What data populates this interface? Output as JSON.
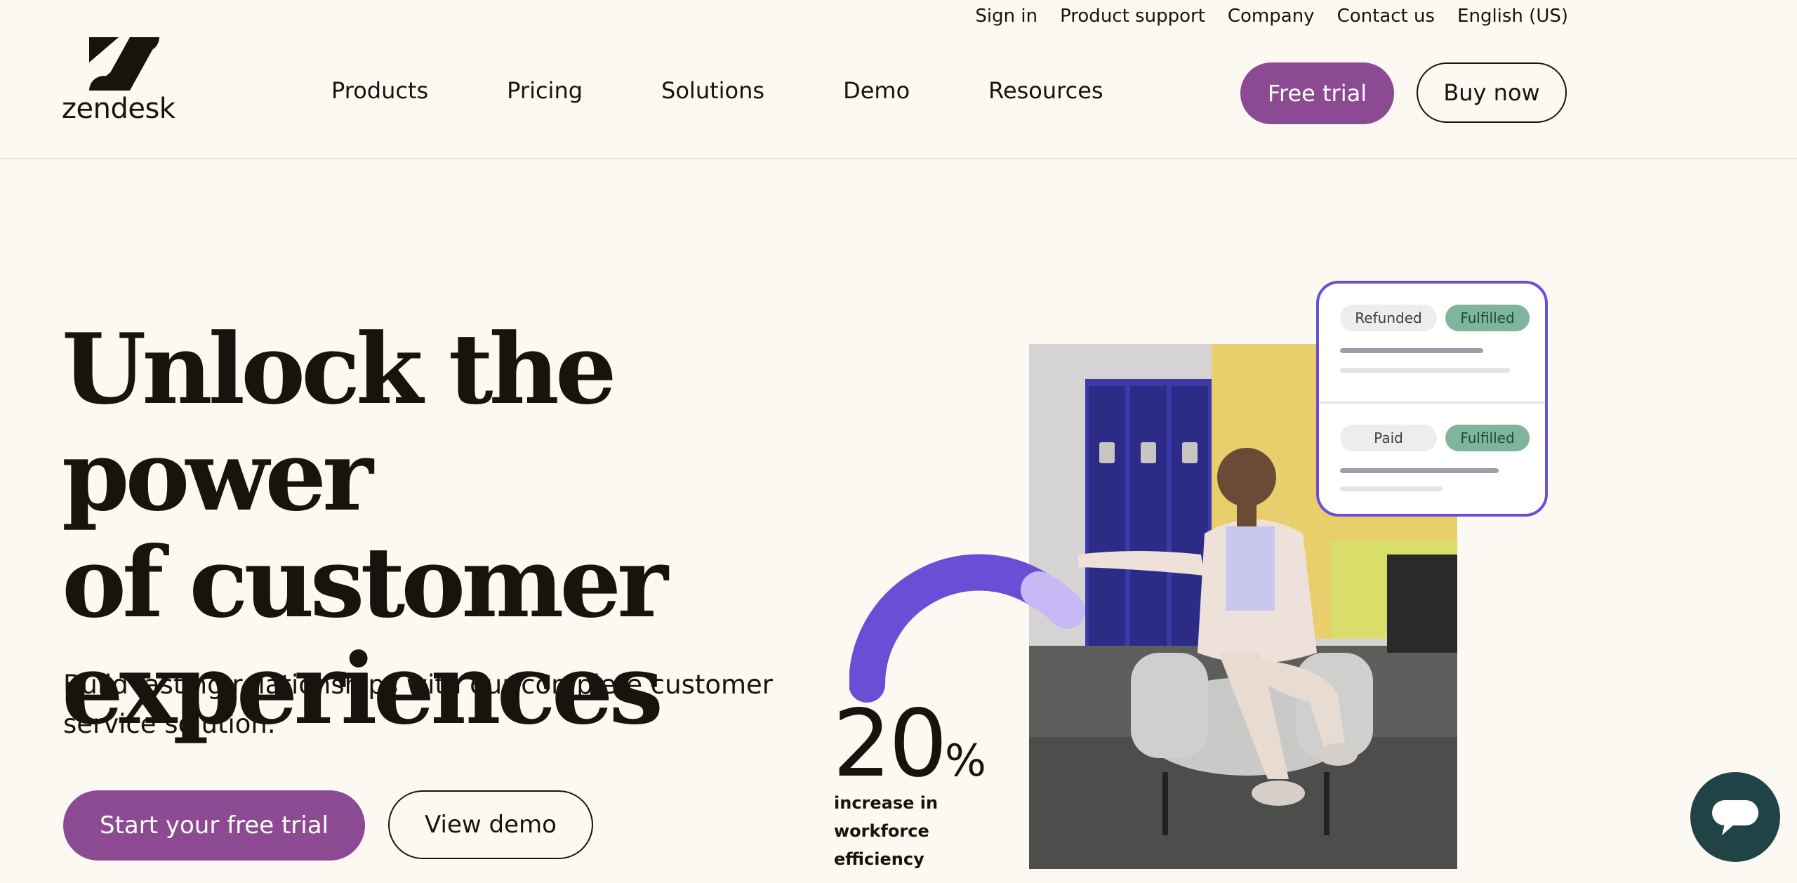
{
  "utility_nav": [
    "Sign in",
    "Product support",
    "Company",
    "Contact us",
    "English (US)"
  ],
  "brand": {
    "name": "zendesk"
  },
  "main_nav": [
    "Products",
    "Pricing",
    "Solutions",
    "Demo",
    "Resources"
  ],
  "header_buttons": {
    "free_trial": "Free trial",
    "buy_now": "Buy now"
  },
  "hero": {
    "title_lines": [
      "Unlock the power",
      "of customer",
      "experiences"
    ],
    "subtitle": "Build lasting relationships with our complete customer service solution.",
    "cta_primary": "Start your free trial",
    "cta_secondary": "View demo"
  },
  "stat": {
    "value": "20",
    "unit": "%",
    "label": "increase in workforce efficiency"
  },
  "status_card": {
    "rows": [
      {
        "status": "Refunded",
        "fulfillment": "Fulfilled"
      },
      {
        "status": "Paid",
        "fulfillment": "Fulfilled"
      }
    ]
  },
  "colors": {
    "background": "#fcf9f3",
    "brand_purple": "#8c4a93",
    "accent_violet": "#6a4fd6",
    "chat_teal": "#204446",
    "fulfilled_green": "#7fb59c"
  },
  "icons": {
    "logo": "zendesk-logo",
    "chat": "chat-bubble-icon"
  }
}
